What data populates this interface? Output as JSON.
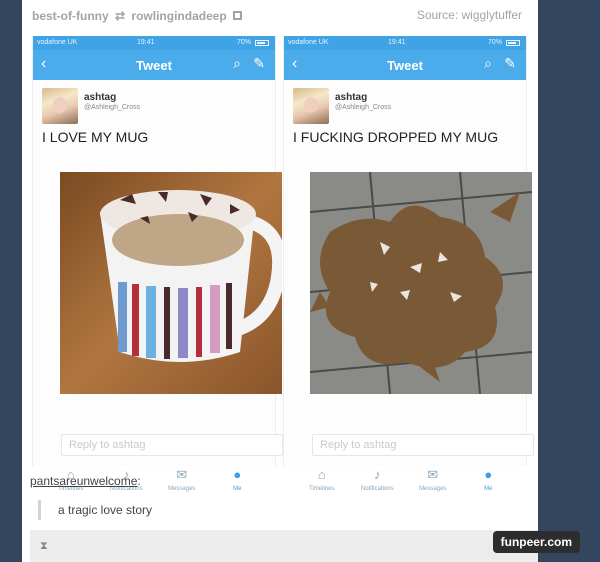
{
  "header": {
    "source_blog": "best-of-funny",
    "reblogger": "rowlingindadeep",
    "source_credit": "Source: wigglytuffer"
  },
  "phone_status": {
    "carrier": "vodafone UK",
    "time": "19:41",
    "battery": "70%"
  },
  "nav": {
    "title": "Tweet"
  },
  "tweets": [
    {
      "username": "ashtag",
      "handle": "@Ashleigh_Cross",
      "text": "I LOVE MY MUG",
      "reply_placeholder": "Reply to ashtag"
    },
    {
      "username": "ashtag",
      "handle": "@Ashleigh_Cross",
      "text": "I FUCKING DROPPED MY MUG",
      "reply_placeholder": "Reply to ashtag"
    }
  ],
  "tabs": [
    {
      "label": "Timelines",
      "icon": "home-icon"
    },
    {
      "label": "Notifications",
      "icon": "bell-icon"
    },
    {
      "label": "Messages",
      "icon": "envelope-icon"
    },
    {
      "label": "Me",
      "icon": "person-icon"
    }
  ],
  "comment": {
    "user": "pantsareunwelcome",
    "text": "a tragic love story"
  },
  "watermark": "funpeer.com",
  "colors": {
    "twitter_blue": "#4bacec",
    "page_background": "#34465d"
  }
}
